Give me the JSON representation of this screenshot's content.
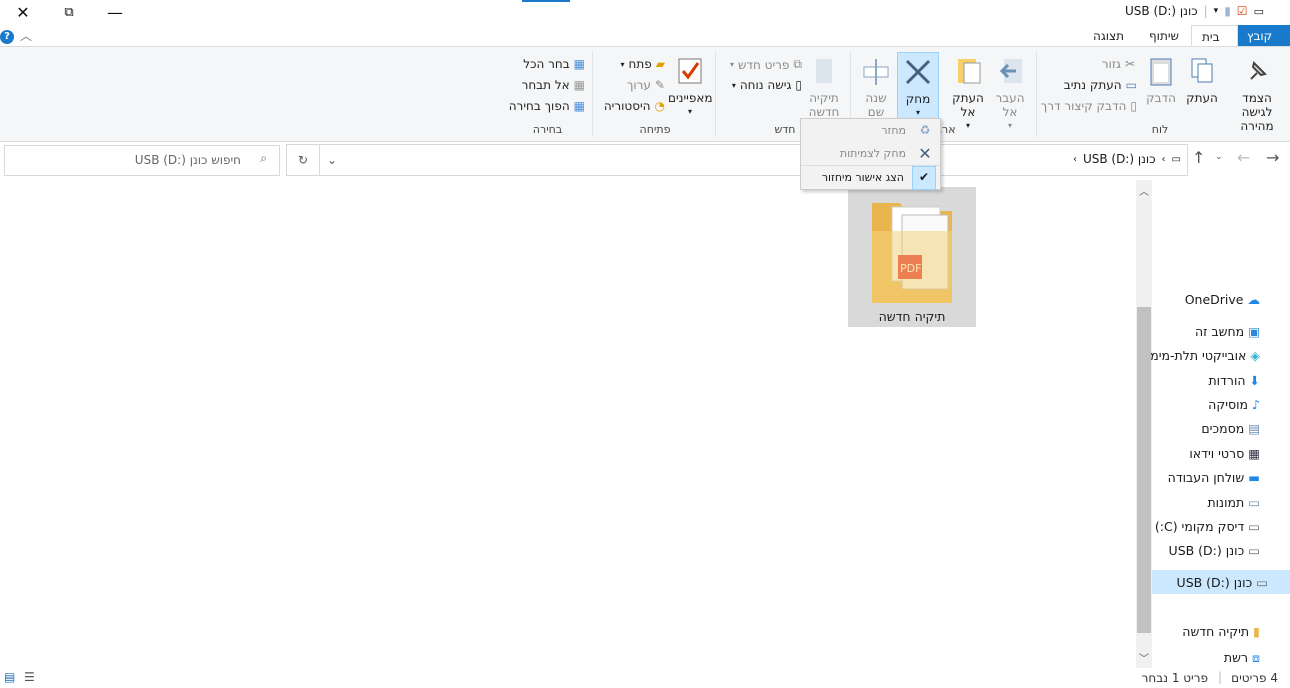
{
  "window": {
    "title": "כונן USB (D:)"
  },
  "tabs": [
    "קובץ",
    "בית",
    "שיתוף",
    "תצוגה"
  ],
  "ribbon": {
    "clipboard": {
      "pin": "הצמד לגישה מהירה",
      "copy": "העתק",
      "paste": "הדבק",
      "cut": "גזור",
      "copy_path": "העתק נתיב",
      "paste_shortcut": "הדבק קיצור דרך",
      "label": "לוח"
    },
    "organize": {
      "move_to": "העבר אל",
      "copy_to": "העתק אל",
      "delete": "מחק",
      "rename": "שנה שם",
      "label": "ארגן"
    },
    "new": {
      "new_folder": "תיקיה חדשה",
      "new_item": "פריט חדש",
      "easy_access": "גישה נוחה",
      "label": "חדש"
    },
    "open": {
      "properties": "מאפיינים",
      "open": "פתח",
      "edit": "ערוך",
      "history": "היסטוריה",
      "label": "פתיחה"
    },
    "select": {
      "select_all": "בחר הכל",
      "select_none": "אל תבחר",
      "invert": "הפוך בחירה",
      "label": "בחירה"
    }
  },
  "delete_menu": {
    "items": [
      "מחזר",
      "מחק לצמיתות",
      "הצג אישור מיחזור"
    ]
  },
  "address": {
    "crumbs": [
      "כונן USB (D:)"
    ],
    "search_placeholder": "חיפוש כונן USB (D:)"
  },
  "files": [
    {
      "name": "תיקיה חדשה"
    }
  ],
  "nav": {
    "items": [
      "OneDrive",
      "מחשב זה",
      "אובייקטי תלת-מימד",
      "הורדות",
      "מוסיקה",
      "מסמכים",
      "סרטי וידאו",
      "שולחן העבודה",
      "תמונות",
      "דיסק מקומי (C:)",
      "כונן USB (D:)",
      "כונן USB (D:)",
      "תיקיה חדשה",
      "רשת"
    ]
  },
  "status": {
    "count": "4 פריטים",
    "selected": "פריט 1 נבחר"
  },
  "colors": {
    "accent": "#1979ca",
    "selection": "#cce8ff"
  }
}
